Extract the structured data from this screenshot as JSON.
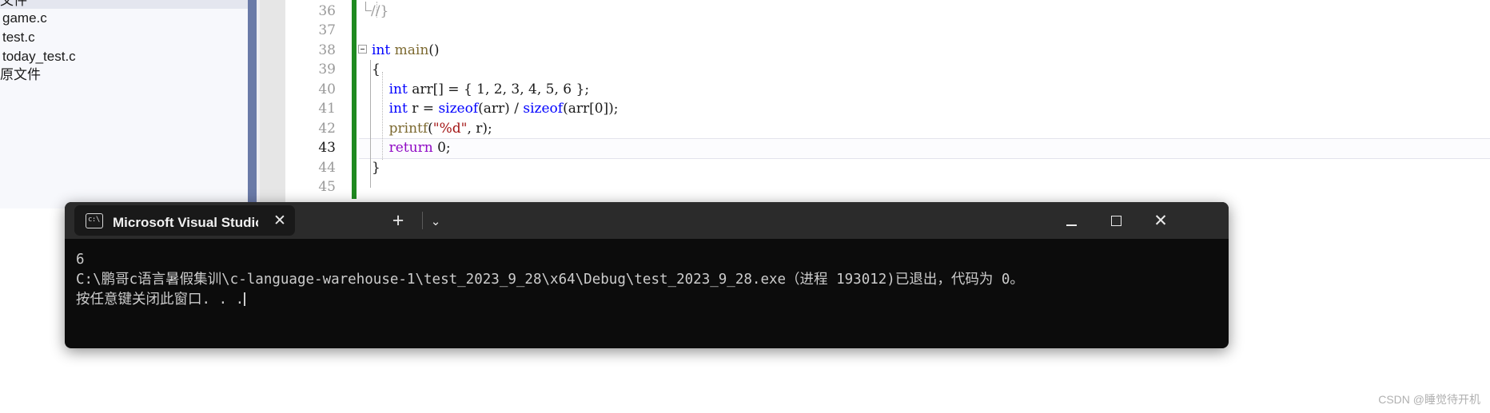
{
  "solution_explorer": {
    "header_label": "文件",
    "items": [
      {
        "label": "game.c"
      },
      {
        "label": "test.c"
      },
      {
        "label": "today_test.c"
      },
      {
        "label": "原文件"
      }
    ]
  },
  "editor": {
    "line_numbers": [
      "36",
      "37",
      "38",
      "39",
      "40",
      "41",
      "42",
      "43",
      "44",
      "45"
    ],
    "current_line": "43",
    "lines": [
      {
        "num": "36",
        "tokens": [
          {
            "t": "//}",
            "c": "com-gray"
          }
        ]
      },
      {
        "num": "37",
        "tokens": []
      },
      {
        "num": "38",
        "tokens": [
          {
            "t": "int",
            "c": "kw-blue"
          },
          {
            "t": " ",
            "c": "plain"
          },
          {
            "t": "main",
            "c": "fn-brown"
          },
          {
            "t": "()",
            "c": "punc"
          }
        ]
      },
      {
        "num": "39",
        "tokens": [
          {
            "t": "{",
            "c": "punc"
          }
        ]
      },
      {
        "num": "40",
        "tokens": [
          {
            "t": "    ",
            "c": "plain"
          },
          {
            "t": "int",
            "c": "kw-blue"
          },
          {
            "t": " ",
            "c": "plain"
          },
          {
            "t": "arr",
            "c": "plain"
          },
          {
            "t": "[] = { ",
            "c": "punc"
          },
          {
            "t": "1, 2, 3, 4, 5, 6",
            "c": "plain"
          },
          {
            "t": " };",
            "c": "punc"
          }
        ]
      },
      {
        "num": "41",
        "tokens": [
          {
            "t": "    ",
            "c": "plain"
          },
          {
            "t": "int",
            "c": "kw-blue"
          },
          {
            "t": " r = ",
            "c": "plain"
          },
          {
            "t": "sizeof",
            "c": "kw-blue"
          },
          {
            "t": "(arr) / ",
            "c": "plain"
          },
          {
            "t": "sizeof",
            "c": "kw-blue"
          },
          {
            "t": "(arr[",
            "c": "plain"
          },
          {
            "t": "0",
            "c": "plain"
          },
          {
            "t": "]);",
            "c": "plain"
          }
        ]
      },
      {
        "num": "42",
        "tokens": [
          {
            "t": "    ",
            "c": "plain"
          },
          {
            "t": "printf",
            "c": "fn-brown"
          },
          {
            "t": "(",
            "c": "punc"
          },
          {
            "t": "\"%d\"",
            "c": "str-red"
          },
          {
            "t": ", r);",
            "c": "punc"
          }
        ]
      },
      {
        "num": "43",
        "tokens": [
          {
            "t": "    ",
            "c": "plain"
          },
          {
            "t": "return",
            "c": "kw-purple"
          },
          {
            "t": " ",
            "c": "plain"
          },
          {
            "t": "0",
            "c": "plain"
          },
          {
            "t": ";",
            "c": "punc"
          }
        ]
      },
      {
        "num": "44",
        "tokens": [
          {
            "t": "}",
            "c": "punc"
          }
        ]
      },
      {
        "num": "45",
        "tokens": []
      }
    ],
    "code_text": {
      "l36": "//}",
      "l38_kw": "int",
      "l38_fn": "main",
      "l38_tail": "()",
      "l39": "{",
      "l40_kw": "int",
      "l40_rest": " arr[] = { 1, 2, 3, 4, 5, 6 };",
      "l41_kw1": "int",
      "l41_mid1": " r = ",
      "l41_kw2": "sizeof",
      "l41_mid2": "(arr) / ",
      "l41_kw3": "sizeof",
      "l41_tail": "(arr[0]);",
      "l42_fn": "printf",
      "l42_open": "(",
      "l42_str": "\"%d\"",
      "l42_tail": ", r);",
      "l43_kw": "return",
      "l43_tail": " 0;",
      "l44": "}"
    }
  },
  "console": {
    "tab": {
      "icon": "cmd-prompt-icon",
      "icon_glyph": "c:\\",
      "title": "Microsoft Visual Studio 调试挡",
      "close_glyph": "✕"
    },
    "new_tab_glyph": "+",
    "dropdown_glyph": "⌄",
    "window_controls": {
      "minimize": "minimize-icon",
      "maximize": "maximize-icon",
      "close_glyph": "✕"
    },
    "output": [
      "6",
      "C:\\鹏哥c语言暑假集训\\c-language-warehouse-1\\test_2023_9_28\\x64\\Debug\\test_2023_9_28.exe（进程 193012)已退出，代码为 0。",
      "按任意键关闭此窗口. . ."
    ]
  },
  "watermark": {
    "text": "CSDN @睡觉待开机"
  }
}
